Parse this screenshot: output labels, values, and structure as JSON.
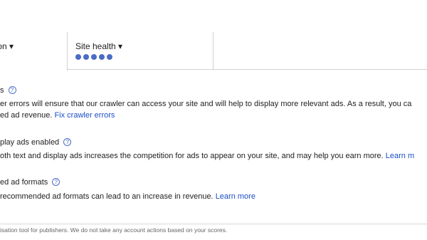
{
  "tabs": {
    "first_label": "on ▾",
    "site_health_label": "Site health ▾",
    "site_health_rating": 5
  },
  "sections": [
    {
      "title": "s",
      "line1": "er errors will ensure that our crawler can access your site and will help to display more relevant ads. As a result, you ca",
      "line2_text": "ed ad revenue.",
      "line2_link": "Fix crawler errors"
    },
    {
      "title": "play ads enabled",
      "line1_text": "oth text and display ads increases the competition for ads to appear on your site, and may help you earn more.",
      "line1_link": "Learn m"
    },
    {
      "title": "ed ad formats",
      "line1_text": "recommended ad formats can lead to an increase in revenue.",
      "line1_link": "Learn more"
    }
  ],
  "footer": {
    "text": "isation tool for publishers. We do not take any account actions based on your scores."
  },
  "icons": {
    "help": "help-circle-icon",
    "rating_dot": "filled-circle"
  },
  "colors": {
    "link": "#1a4fc7",
    "rating_dot": "#4a6dc4"
  }
}
